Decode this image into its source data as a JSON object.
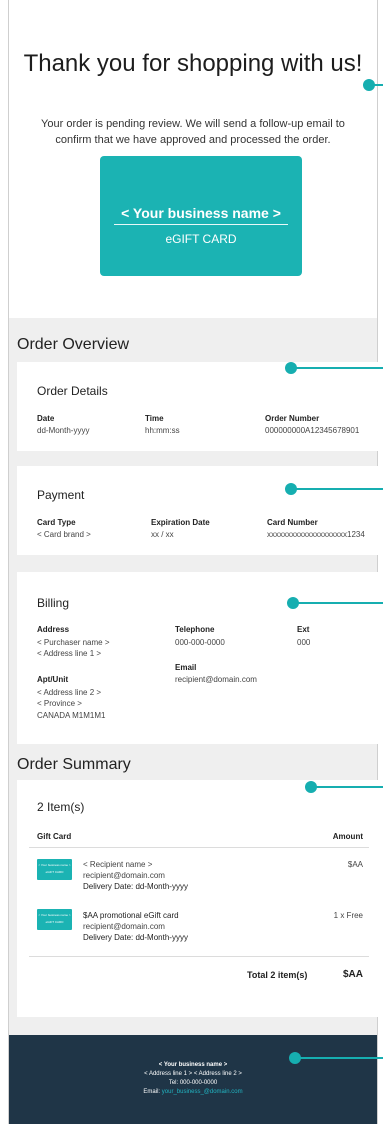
{
  "hero": {
    "title": "Thank you for shopping with us!",
    "message": "Your order is pending review. We will send a follow-up email to confirm that we have approved and processed the order."
  },
  "gift_card": {
    "business_name": "< Your business name >",
    "label": "eGIFT CARD",
    "mini_business": "< Your business name >",
    "mini_label": "eGIFT CARD"
  },
  "order_overview": {
    "heading": "Order Overview",
    "details": {
      "title": "Order Details",
      "date_label": "Date",
      "date_value": "dd-Month-yyyy",
      "time_label": "Time",
      "time_value": "hh:mm:ss",
      "number_label": "Order Number",
      "number_value": "000000000A12345678901"
    },
    "payment": {
      "title": "Payment",
      "card_type_label": "Card Type",
      "card_type_value": "< Card brand >",
      "exp_label": "Expiration Date",
      "exp_value": "xx / xx",
      "card_number_label": "Card Number",
      "card_number_value": "xxxxxxxxxxxxxxxxxxxx1234"
    },
    "billing": {
      "title": "Billing",
      "address_label": "Address",
      "address_line_name": "< Purchaser name >",
      "address_line_1": "< Address line 1 >",
      "apt_label": "Apt/Unit",
      "apt_line_2": "< Address line 2 >",
      "apt_province": "< Province >",
      "apt_postal": "CANADA M1M1M1",
      "telephone_label": "Telephone",
      "telephone_value": "000-000-0000",
      "ext_label": "Ext",
      "ext_value": "000",
      "email_label": "Email",
      "email_value": "recipient@domain.com"
    }
  },
  "order_summary": {
    "heading": "Order Summary",
    "count": "2 Item(s)",
    "col_gift_card": "Gift Card",
    "col_amount": "Amount",
    "items": [
      {
        "line1": "< Recipient name >",
        "line2": "recipient@domain.com",
        "delivery_label": "Delivery Date:",
        "delivery_value": "dd-Month-yyyy",
        "amount": "$AA"
      },
      {
        "line1": "$AA promotional eGift card",
        "line2": "recipient@domain.com",
        "delivery_label": "Delivery Date:",
        "delivery_value": "dd-Month-yyyy",
        "amount": "1 x Free"
      }
    ],
    "total_label": "Total 2 item(s)",
    "total_value": "$AA"
  },
  "footer": {
    "business": "< Your business name >",
    "address": "< Address line 1 > < Address line 2 >",
    "tel": "Tel: 000-000-0000",
    "email_label": "Email: ",
    "email_value": "your_business_@domain.com"
  },
  "colors": {
    "accent": "#16aeb0",
    "card": "#1bb3b3",
    "footer": "#1f3547",
    "panel_bg": "#efefef"
  }
}
